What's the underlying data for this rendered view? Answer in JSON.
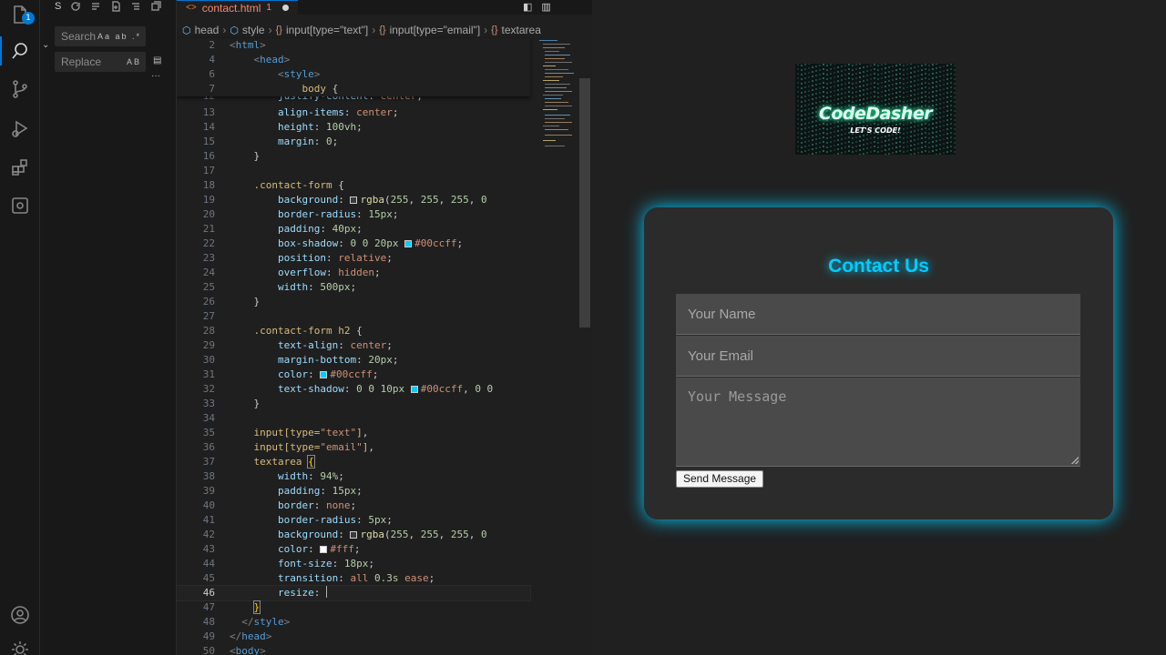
{
  "activity_bar": {
    "items": [
      "explorer-icon",
      "search-icon",
      "source-control-icon",
      "run-debug-icon",
      "extensions-icon",
      "remote-icon",
      "account-icon",
      "settings-gear-icon"
    ],
    "explorer_badge": "1"
  },
  "sidebar": {
    "title": "S",
    "search_placeholder": "Search",
    "search_options": "Aa ab .*",
    "replace_placeholder": "Replace",
    "replace_option": "AB",
    "more": "···"
  },
  "editor": {
    "tab": {
      "filename": "contact.html",
      "problems": "1"
    },
    "breadcrumb": [
      "head",
      "style",
      "input[type=\"text\"]",
      "input[type=\"email\"]",
      "textarea"
    ],
    "current_line": "46"
  },
  "preview": {
    "logo": {
      "title": "CodeDasher",
      "subtitle": "LET'S CODE!"
    },
    "form": {
      "heading": "Contact Us",
      "name_placeholder": "Your Name",
      "email_placeholder": "Your Email",
      "message_placeholder": "Your Message",
      "submit_label": "Send Message"
    }
  },
  "colors": {
    "accent": "#00ccff",
    "form_bg": "#2b2b2b",
    "editor_bg": "#1f1f1f"
  }
}
